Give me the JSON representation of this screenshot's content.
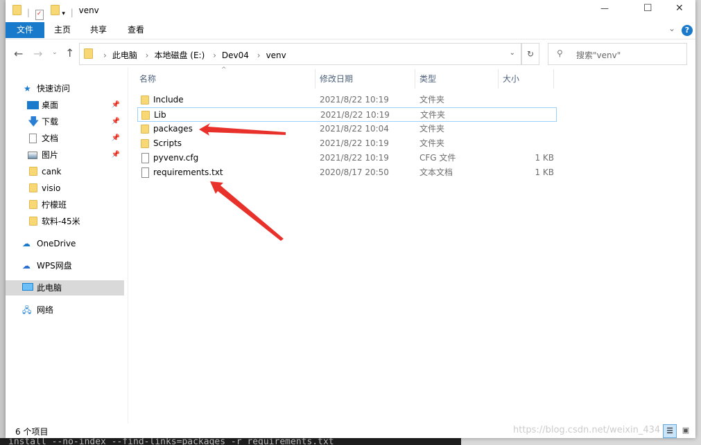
{
  "window": {
    "title": "venv",
    "controls": {
      "minimize": "—",
      "maximize": "☐",
      "close": "✕"
    }
  },
  "ribbon": {
    "tabs": [
      "文件",
      "主页",
      "共享",
      "查看"
    ],
    "help": "?",
    "collapse": "⌄"
  },
  "address": {
    "crumbs": [
      "此电脑",
      "本地磁盘 (E:)",
      "Dev04",
      "venv"
    ],
    "search_placeholder": "搜索\"venv\""
  },
  "nav": {
    "quick_access": "快速访问",
    "items": [
      {
        "label": "桌面",
        "pinned": true
      },
      {
        "label": "下载",
        "pinned": true
      },
      {
        "label": "文档",
        "pinned": true
      },
      {
        "label": "图片",
        "pinned": true
      },
      {
        "label": "cank"
      },
      {
        "label": "visio"
      },
      {
        "label": "柠檬班"
      },
      {
        "label": "软料-45米"
      }
    ],
    "onedrive": "OneDrive",
    "wps": "WPS网盘",
    "this_pc": "此电脑",
    "network": "网络"
  },
  "columns": [
    "名称",
    "修改日期",
    "类型",
    "大小"
  ],
  "files": [
    {
      "name": "Include",
      "date": "2021/8/22 10:19",
      "type": "文件夹",
      "size": "",
      "kind": "folder"
    },
    {
      "name": "Lib",
      "date": "2021/8/22 10:19",
      "type": "文件夹",
      "size": "",
      "kind": "folder"
    },
    {
      "name": "packages",
      "date": "2021/8/22 10:04",
      "type": "文件夹",
      "size": "",
      "kind": "folder"
    },
    {
      "name": "Scripts",
      "date": "2021/8/22 10:19",
      "type": "文件夹",
      "size": "",
      "kind": "folder"
    },
    {
      "name": "pyvenv.cfg",
      "date": "2021/8/22 10:19",
      "type": "CFG 文件",
      "size": "1 KB",
      "kind": "file"
    },
    {
      "name": "requirements.txt",
      "date": "2020/8/17 20:50",
      "type": "文本文档",
      "size": "1 KB",
      "kind": "file"
    }
  ],
  "status": "6 个项目",
  "watermark": "https://blog.csdn.net/weixin_434",
  "terminal": "install --no-index --find-links=packages -r requirements.txt",
  "colors": {
    "accent": "#1979ca",
    "arrow": "#e8312a",
    "selected": "#d9d9d9"
  }
}
